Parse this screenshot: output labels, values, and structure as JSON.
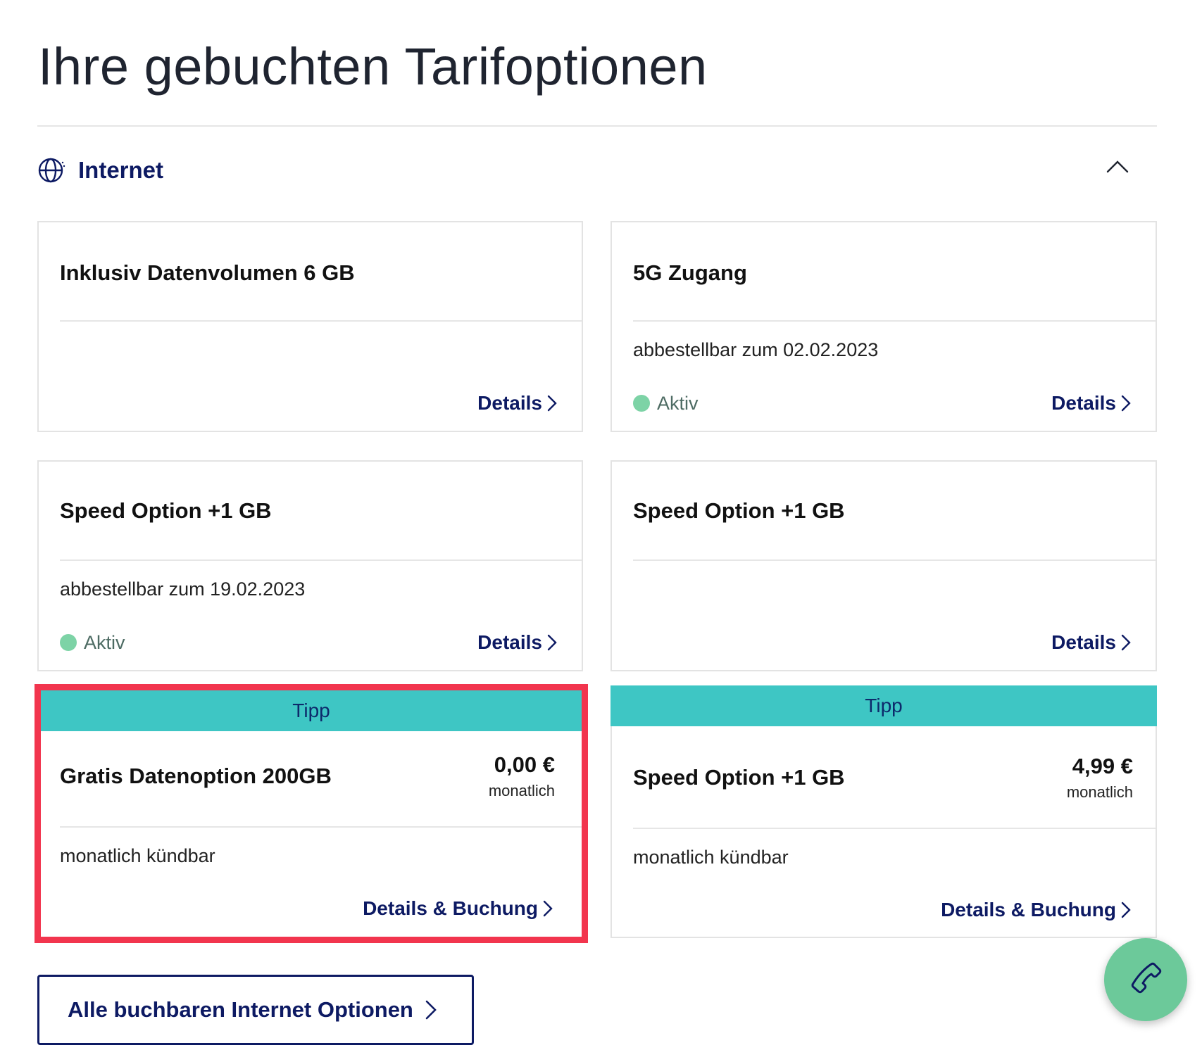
{
  "page": {
    "title": "Ihre gebuchten Tarifoptionen"
  },
  "section": {
    "label": "Internet",
    "icon": "globe-icon",
    "collapse_icon": "chevron-up-icon"
  },
  "colors": {
    "accent": "#0d1a63",
    "tipp_banner": "#3ec6c4",
    "status_active": "#7dd3a6",
    "highlight": "#f2354e",
    "call_button": "#6cc99a"
  },
  "booked_options": [
    {
      "title": "Inklusiv Datenvolumen 6 GB",
      "note": "",
      "status": "",
      "link": "Details"
    },
    {
      "title": "5G Zugang",
      "note": "abbestellbar zum 02.02.2023",
      "status": "Aktiv",
      "link": "Details"
    },
    {
      "title": "Speed Option +1 GB",
      "note": "abbestellbar zum 19.02.2023",
      "status": "Aktiv",
      "link": "Details"
    },
    {
      "title": "Speed Option +1 GB",
      "note": "",
      "status": "",
      "link": "Details"
    }
  ],
  "offers": [
    {
      "banner": "Tipp",
      "title": "Gratis Datenoption 200GB",
      "price": "0,00 €",
      "period": "monatlich",
      "note": "monatlich kündbar",
      "link": "Details & Buchung",
      "highlighted": true
    },
    {
      "banner": "Tipp",
      "title": "Speed Option +1 GB",
      "price": "4,99 €",
      "period": "monatlich",
      "note": "monatlich kündbar",
      "link": "Details & Buchung",
      "highlighted": false
    }
  ],
  "footer": {
    "all_options_label": "Alle buchbaren Internet Optionen",
    "call_icon": "phone-icon"
  }
}
